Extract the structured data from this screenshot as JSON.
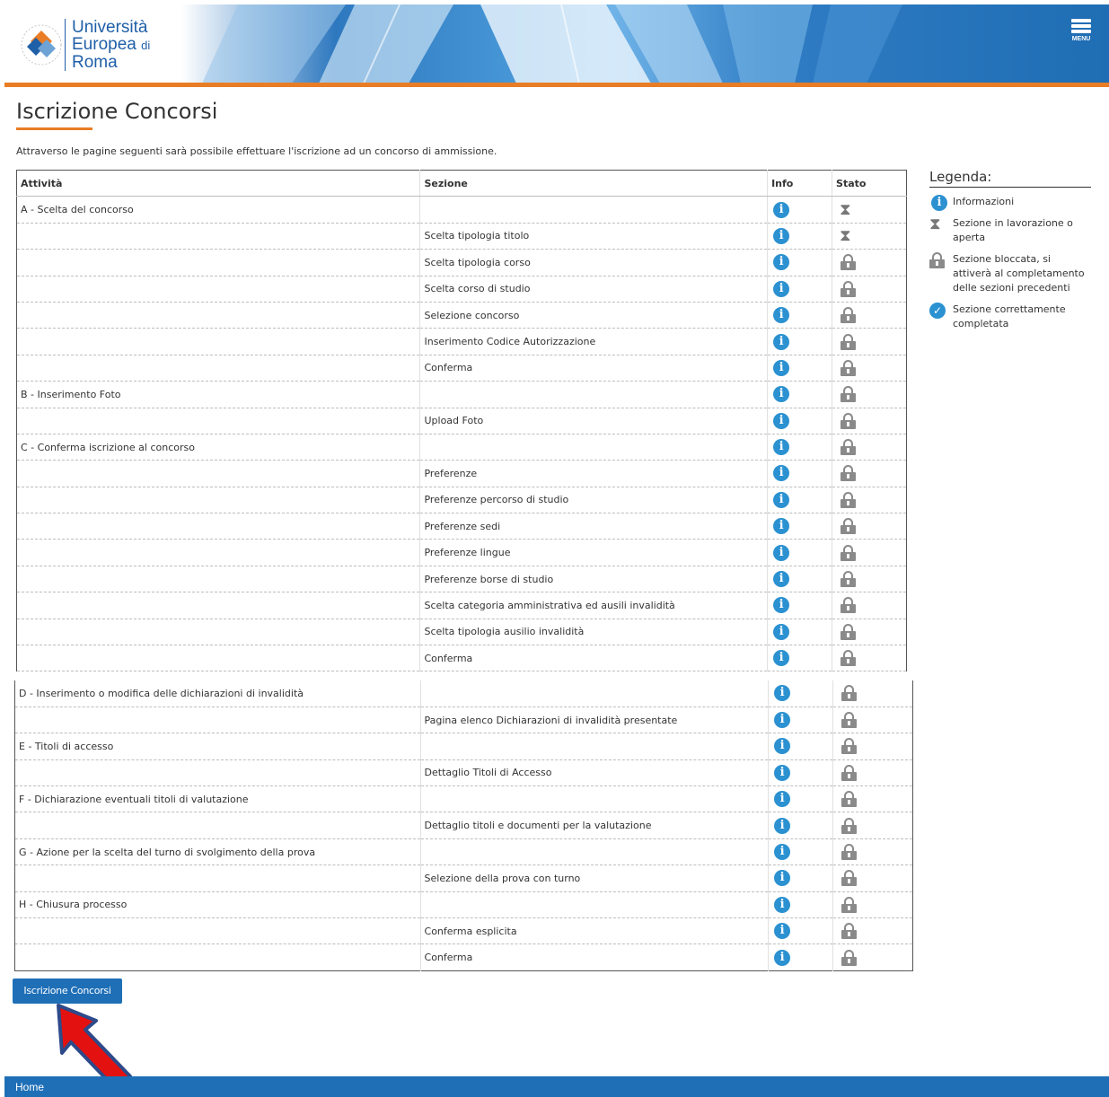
{
  "header": {
    "logo_lines": [
      "Università",
      "Europea",
      "di",
      "Roma"
    ],
    "menu_label": "MENU"
  },
  "page": {
    "title": "Iscrizione Concorsi",
    "intro": "Attraverso le pagine seguenti sarà possibile effettuare l'iscrizione ad un concorso di ammissione."
  },
  "table": {
    "headers": {
      "attivita": "Attività",
      "sezione": "Sezione",
      "info": "Info",
      "stato": "Stato"
    },
    "rows1": [
      {
        "attivita": "A - Scelta del concorso",
        "sezione": "",
        "stato": "hourglass"
      },
      {
        "attivita": "",
        "sezione": "Scelta tipologia titolo",
        "stato": "hourglass"
      },
      {
        "attivita": "",
        "sezione": "Scelta tipologia corso",
        "stato": "lock"
      },
      {
        "attivita": "",
        "sezione": "Scelta corso di studio",
        "stato": "lock"
      },
      {
        "attivita": "",
        "sezione": "Selezione concorso",
        "stato": "lock"
      },
      {
        "attivita": "",
        "sezione": "Inserimento Codice Autorizzazione",
        "stato": "lock"
      },
      {
        "attivita": "",
        "sezione": "Conferma",
        "stato": "lock"
      },
      {
        "attivita": "B - Inserimento Foto",
        "sezione": "",
        "stato": "lock"
      },
      {
        "attivita": "",
        "sezione": "Upload Foto",
        "stato": "lock"
      },
      {
        "attivita": "C - Conferma iscrizione al concorso",
        "sezione": "",
        "stato": "lock"
      },
      {
        "attivita": "",
        "sezione": "Preferenze",
        "stato": "lock"
      },
      {
        "attivita": "",
        "sezione": "Preferenze percorso di studio",
        "stato": "lock"
      },
      {
        "attivita": "",
        "sezione": "Preferenze sedi",
        "stato": "lock"
      },
      {
        "attivita": "",
        "sezione": "Preferenze lingue",
        "stato": "lock"
      },
      {
        "attivita": "",
        "sezione": "Preferenze borse di studio",
        "stato": "lock"
      },
      {
        "attivita": "",
        "sezione": "Scelta categoria amministrativa ed ausili invalidità",
        "stato": "lock"
      },
      {
        "attivita": "",
        "sezione": "Scelta tipologia ausilio invalidità",
        "stato": "lock"
      },
      {
        "attivita": "",
        "sezione": "Conferma",
        "stato": "lock"
      }
    ],
    "rows2": [
      {
        "attivita": "D - Inserimento o modifica delle dichiarazioni di invalidità",
        "sezione": "",
        "stato": "lock"
      },
      {
        "attivita": "",
        "sezione": "Pagina elenco Dichiarazioni di invalidità presentate",
        "stato": "lock"
      },
      {
        "attivita": "E - Titoli di accesso",
        "sezione": "",
        "stato": "lock"
      },
      {
        "attivita": "",
        "sezione": "Dettaglio Titoli di Accesso",
        "stato": "lock"
      },
      {
        "attivita": "F - Dichiarazione eventuali titoli di valutazione",
        "sezione": "",
        "stato": "lock"
      },
      {
        "attivita": "",
        "sezione": "Dettaglio titoli e documenti per la valutazione",
        "stato": "lock"
      },
      {
        "attivita": "G - Azione per la scelta del turno di svolgimento della prova",
        "sezione": "",
        "stato": "lock"
      },
      {
        "attivita": "",
        "sezione": "Selezione della prova con turno",
        "stato": "lock"
      },
      {
        "attivita": "H - Chiusura processo",
        "sezione": "",
        "stato": "lock"
      },
      {
        "attivita": "",
        "sezione": "Conferma esplicita",
        "stato": "lock"
      },
      {
        "attivita": "",
        "sezione": "Conferma",
        "stato": "lock"
      }
    ]
  },
  "legend": {
    "title": "Legenda:",
    "items": [
      {
        "icon": "info-icon",
        "label": "Informazioni"
      },
      {
        "icon": "hourglass-icon",
        "label": "Sezione in lavorazione o aperta"
      },
      {
        "icon": "lock-icon",
        "label": "Sezione bloccata, si attiverà al completamento delle sezioni precedenti"
      },
      {
        "icon": "check-icon",
        "label": "Sezione correttamente completata"
      }
    ]
  },
  "button": {
    "label": "Iscrizione Concorsi"
  },
  "footer": {
    "home_label": "Home"
  },
  "colors": {
    "brand_blue": "#1f6fb7",
    "accent_orange": "#e87d25",
    "info_blue": "#2b91d1",
    "arrow_red": "#e3110f"
  }
}
